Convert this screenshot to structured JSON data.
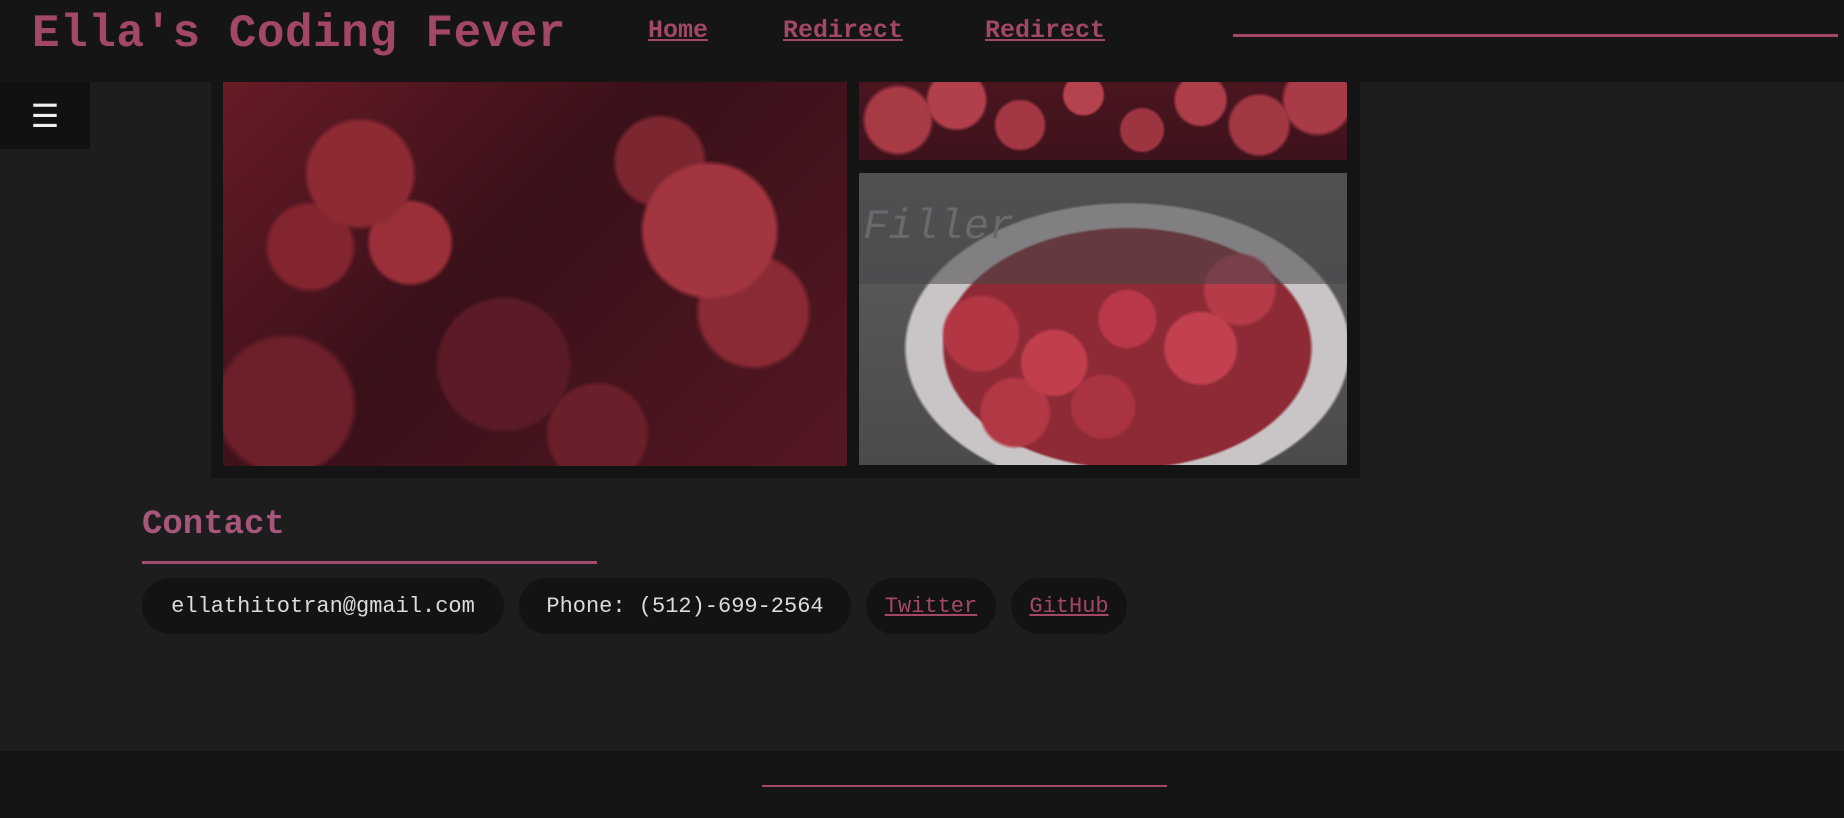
{
  "header": {
    "title": "Ella's Coding Fever",
    "nav": [
      {
        "label": "Home"
      },
      {
        "label": "Redirect"
      },
      {
        "label": "Redirect"
      }
    ]
  },
  "menu": {
    "icon": "hamburger-menu-icon",
    "glyph": "☰"
  },
  "gallery": {
    "filler_label": "Filler"
  },
  "contact": {
    "title": "Contact",
    "email": "ellathitotran@gmail.com",
    "phone": "Phone: (512)-699-2564",
    "twitter": "Twitter",
    "github": "GitHub"
  },
  "colors": {
    "accent": "#a34766",
    "background": "#1d1d1d",
    "header_bg": "#151515"
  }
}
